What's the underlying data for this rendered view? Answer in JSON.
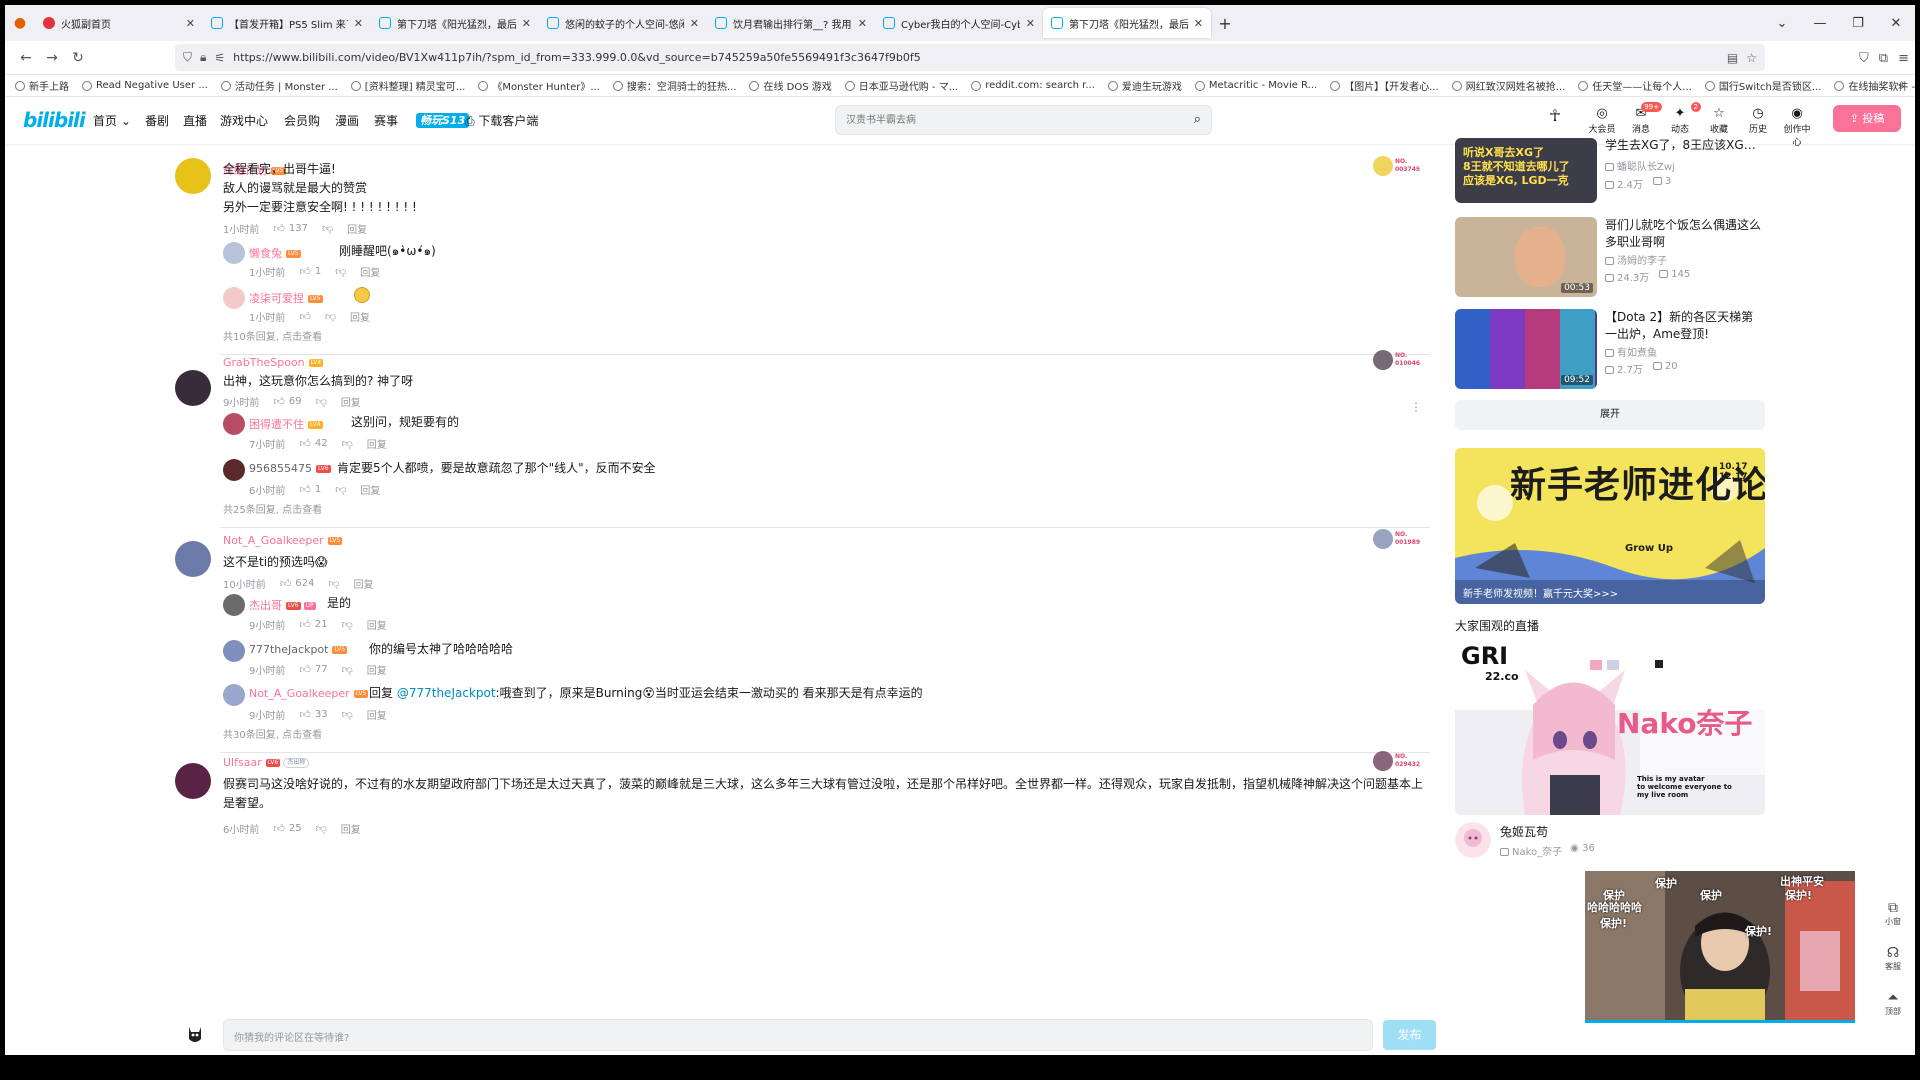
{
  "browser": {
    "tabs": [
      {
        "title": "火狐副首页",
        "fav": "fox",
        "active": false
      },
      {
        "title": "【首发开箱】PS5 Slim 来了! 有",
        "fav": "bili",
        "active": false
      },
      {
        "title": "第下刀塔《阳光猛烈，最后一击",
        "fav": "bili",
        "active": false
      },
      {
        "title": "悠闲的蚊子的个人空间-悠闲的",
        "fav": "bili",
        "active": false
      },
      {
        "title": "饮月君输出排行第__? 我用神器",
        "fav": "bili",
        "active": false
      },
      {
        "title": "Cyber我白的个人空间-Cyber我",
        "fav": "bili",
        "active": false
      },
      {
        "title": "第下刀塔《阳光猛烈，最后一击",
        "fav": "bili",
        "active": true
      }
    ],
    "new_tab_icon": "+",
    "url": "https://www.bilibili.com/video/BV1Xw411p7ih/?spm_id_from=333.999.0.0&vd_source=b745259a50fe5569491f3c3647f9b0f5",
    "bookmarks": [
      "新手上路",
      "Read Negative User ...",
      "活动任务 | Monster ...",
      "[资料整理] 精灵宝可...",
      "《Monster Hunter》...",
      "搜索：空洞骑士的狂热...",
      "在线 DOS 游戏",
      "日本亚马逊代购 - マ...",
      "reddit.com: search r...",
      "爱迪生玩游戏",
      "Metacritic - Movie R...",
      "【图片】【开发者心...",
      "网红致汉网姓名被抢...",
      "任天堂——让每个人...",
      "国行Switch是否锁区...",
      "在线抽奖软件 - 在线..."
    ]
  },
  "bili": {
    "logo": "bilibili",
    "nav": [
      "首页",
      "番剧",
      "直播",
      "游戏中心",
      "会员购",
      "漫画",
      "赛事",
      "畅玩S13",
      "下载客户端"
    ],
    "search_placeholder": "汉责书半霸去病",
    "icons": [
      {
        "label": "大会员",
        "glyph": "◎",
        "badge": ""
      },
      {
        "label": "消息",
        "glyph": "✉",
        "badge": "99+"
      },
      {
        "label": "动态",
        "glyph": "✦",
        "badge": "2"
      },
      {
        "label": "收藏",
        "glyph": "☆",
        "badge": ""
      },
      {
        "label": "历史",
        "glyph": "◷",
        "badge": ""
      },
      {
        "label": "创作中心",
        "glyph": "◉",
        "badge": ""
      }
    ],
    "upload": "投稿"
  },
  "comments": [
    {
      "user": "辉耀计划",
      "level": "LV5",
      "fan_no": "NO.\n003745",
      "lines": [
        "全程看完，出哥牛逼!",
        "敌人的谩骂就是最大的赞赏",
        "另外一定要注意安全啊! ! ! ! ! ! ! ! !"
      ],
      "time": "1小时前",
      "likes": "137",
      "reply_label": "回复",
      "replies": [
        {
          "user": "懒食兔",
          "level": "LV5",
          "text": "刚睡醒吧(๑•̀ω•́๑)",
          "time": "1小时前",
          "likes": "1"
        },
        {
          "user": "凌柒可爱捏",
          "level": "LV5",
          "text": "",
          "time": "1小时前",
          "likes": ""
        }
      ],
      "more": "共10条回复, 点击查看"
    },
    {
      "user": "GrabTheSpoon",
      "level": "LV4",
      "fan_no": "NO.\n010046",
      "lines": [
        "出神，这玩意你怎么搞到的? 神了呀"
      ],
      "time": "9小时前",
      "likes": "69",
      "reply_label": "回复",
      "replies": [
        {
          "user": "困得遭不住",
          "level": "LV4",
          "text": "这别问，规矩要有的",
          "time": "7小时前",
          "likes": "42"
        },
        {
          "user": "956855475",
          "level": "LV6",
          "text": "肯定要5个人都喷，要是故意疏忽了那个\"线人\"，反而不安全",
          "time": "6小时前",
          "likes": "1"
        }
      ],
      "more": "共25条回复, 点击查看"
    },
    {
      "user": "Not_A_Goalkeeper",
      "level": "LV5",
      "fan_no": "NO.\n001989",
      "lines": [
        "这不是ti的预选吗😱"
      ],
      "time": "10小时前",
      "likes": "624",
      "reply_label": "回复",
      "replies": [
        {
          "user": "杰出哥",
          "level": "LV6",
          "up": "UP",
          "text": "是的",
          "time": "9小时前",
          "likes": "21"
        },
        {
          "user": "777theJackpot",
          "level": "LV5",
          "text": "你的编号太神了哈哈哈哈哈",
          "time": "9小时前",
          "likes": "77"
        },
        {
          "user": "Not_A_Goalkeeper",
          "level": "LV5",
          "reply_word": "回复",
          "mention": "@777theJackpot",
          "text": ":哦查到了，原来是Burning😵当时亚运会结束一激动买的 看来那天是有点幸运的",
          "time": "9小时前",
          "likes": "33"
        }
      ],
      "more": "共30条回复, 点击查看"
    },
    {
      "user": "Ulfsaar",
      "level": "LV6",
      "fan_tag": "杰出称",
      "fan_no": "NO.\n029432",
      "lines": [
        "假赛司马这没啥好说的，不过有的水友期望政府部门下场还是太过天真了，菠菜的巅峰就是三大球，这么多年三大球有管过没啦，还是那个吊样好吧。全世界都一样。还得观众，玩家自发抵制，指望机械降神解决这个问题基本上是奢望。"
      ],
      "time": "6小时前",
      "likes": "25",
      "reply_label": "回复"
    }
  ],
  "comment_box": {
    "placeholder": "你猜我的评论区在等待谁?",
    "post": "发布"
  },
  "recommendations": [
    {
      "title": "学生去XG了，8王应该XG、...",
      "author": "蟠聪队长Zwj",
      "views": "2.4万",
      "danmaku": "3",
      "duration": "",
      "thumb_text": "听说X哥去XG了\n8王就不知道去哪儿了\n应该是XG, LGD一克"
    },
    {
      "title": "哥们儿就吃个饭怎么偶遇这么多职业哥啊",
      "author": "汤姆的李子",
      "views": "24.3万",
      "danmaku": "145",
      "duration": "00:53"
    },
    {
      "title": "【Dota 2】新的各区天梯第一出炉，Ame登顶!",
      "author": "有如煮鱼",
      "views": "2.7万",
      "danmaku": "20",
      "duration": "09:52"
    }
  ],
  "expand": "展开",
  "banner": {
    "title": "新手老师进化论",
    "date": "10.17\n12.17",
    "subtitle": "Grow Up",
    "cta": "新手老师发视频！赢千元大奖>>>"
  },
  "live": {
    "heading": "大家围观的直播",
    "name_overlay": "Nako奈子",
    "caption": "This is my avatar\nto welcome everyone to\nmy live room",
    "title": "兔姬瓦苟",
    "streamer": "Nako_奈子",
    "viewers": "36",
    "top_overlay": "GRI",
    "sub_overlay": "22.co"
  },
  "mini_player": {
    "danmaku": [
      "保护",
      "保护",
      "保护",
      "保护!",
      "出神平安",
      "哈哈哈哈哈",
      "保护!",
      "保护!"
    ]
  },
  "side_tools": [
    {
      "label": "小窗",
      "glyph": "⧉"
    },
    {
      "label": "客服",
      "glyph": "☊"
    },
    {
      "label": "顶部",
      "glyph": "⏶"
    }
  ],
  "colors": {
    "brand": "#00aeec",
    "pink": "#fb7299",
    "meta": "#9499a0"
  }
}
